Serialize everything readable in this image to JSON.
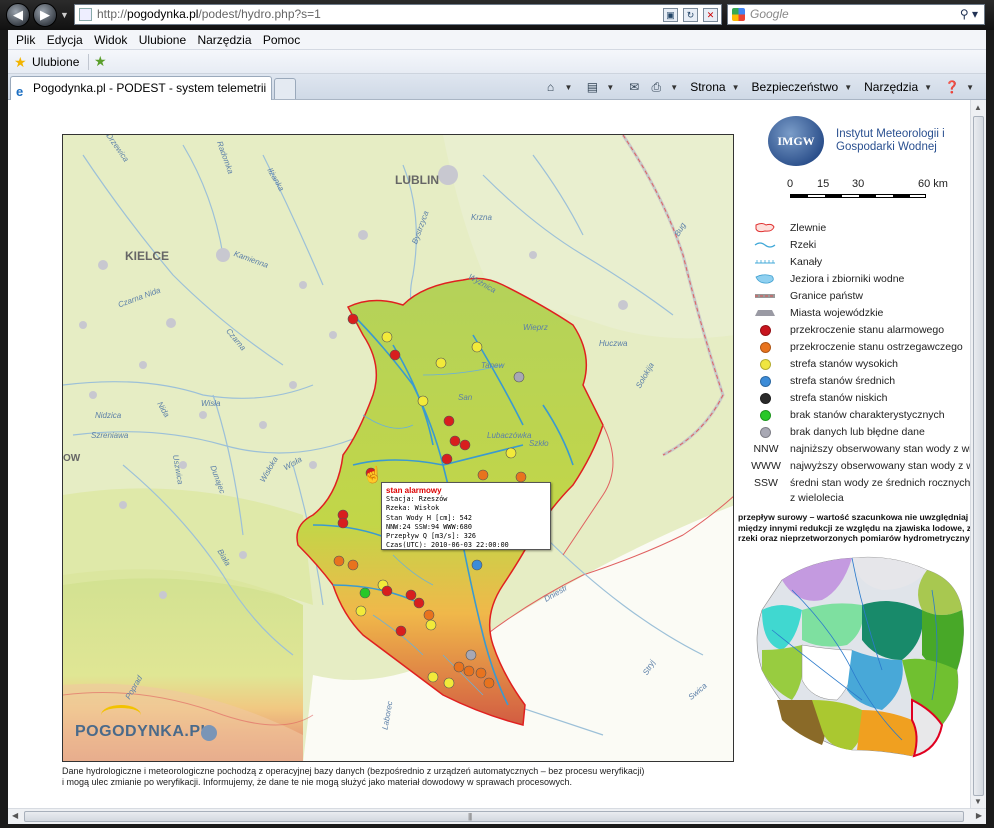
{
  "browser": {
    "url_prefix": "http://",
    "url_domain": "pogodynka.pl",
    "url_path": "/podest/hydro.php?s=1",
    "search_placeholder": "Google",
    "menu": [
      "Plik",
      "Edycja",
      "Widok",
      "Ulubione",
      "Narzędzia",
      "Pomoc"
    ],
    "favorites_label": "Ulubione",
    "tab_title": "Pogodynka.pl - PODEST - system telemetrii",
    "commands": [
      "Strona",
      "Bezpieczeństwo",
      "Narzędzia"
    ]
  },
  "map": {
    "cities": [
      "LUBLIN",
      "KIELCE",
      "OW"
    ],
    "rivers": [
      "Drzewica",
      "Radomka",
      "Iłżanka",
      "Bystrzyca",
      "Wieprz",
      "Bug",
      "Kamienna",
      "Krzna",
      "Czarna Nida",
      "Wyżnica",
      "Huczwa",
      "Tanew",
      "Solokija",
      "Czarna",
      "Wisła",
      "Nida",
      "Nidzica",
      "Wisła",
      "San",
      "Lubaczówka",
      "Szkło",
      "Szreniawa",
      "Dunajec",
      "Uszwica",
      "Wisłoka",
      "Biała",
      "Dniestr",
      "Poprad",
      "Stryj",
      "Laborec",
      "Swica"
    ],
    "logo": "POGODYNKA.PL"
  },
  "tooltip": {
    "title": "stan alarmowy",
    "station": "Stacja: Rzeszów",
    "river": "Rzeka: Wisłok",
    "water_level": "Stan Wody H [cm]: 542",
    "levels": "NNW:24 SSW:94 WWW:680",
    "flow": "Przepływ Q [m3/s]: 326",
    "time": "Czas(UTC): 2010-06-03 22:00:00"
  },
  "legend": {
    "institute": "Instytut Meteorologii i Gospodarki Wodnej",
    "institute_logo": "IMGW",
    "scale_ticks": [
      "0",
      "15",
      "30",
      "60 km"
    ],
    "items": [
      {
        "label": "Zlewnie"
      },
      {
        "label": "Rzeki"
      },
      {
        "label": "Kanały"
      },
      {
        "label": "Jeziora i zbiorniki wodne"
      },
      {
        "label": "Granice państw"
      },
      {
        "label": "Miasta wojewódzkie"
      },
      {
        "label": "przekroczenie stanu alarmowego",
        "color": "#c8141e"
      },
      {
        "label": "przekroczenie stanu ostrzegawczego",
        "color": "#e8731e"
      },
      {
        "label": "strefa stanów wysokich",
        "color": "#f0e640"
      },
      {
        "label": "strefa stanów średnich",
        "color": "#3c8cd8"
      },
      {
        "label": "strefa stanów niskich",
        "color": "#2a2a2a"
      },
      {
        "label": "brak stanów charakterystycznych",
        "color": "#28c828"
      },
      {
        "label": "brak danych lub błędne dane",
        "color": "#a8a8b4"
      }
    ],
    "abbreviations": [
      {
        "abbr": "NNW",
        "text": "najniższy obserwowany stan wody z wie"
      },
      {
        "abbr": "WWW",
        "text": "najwyższy obserwowany stan wody z wi"
      },
      {
        "abbr": "SSW",
        "text": "średni stan wody ze średnich rocznych",
        "text2": "z wielolecia"
      }
    ],
    "flow_note": [
      "przepływ surowy – wartość szacunkowa nie uwzględniaj",
      "między innymi redukcji ze względu na zjawiska lodowe, zar",
      "rzeki oraz nieprzetworzonych pomiarów hydrometrycznych"
    ]
  },
  "footnote": [
    "Dane hydrologiczne i meteorologiczne pochodzą z operacyjnej bazy danych (bezpośrednio z urządzeń automatycznych – bez procesu weryfikacji)",
    "i mogą ulec zmianie po weryfikacji. Informujemy, że dane te nie mogą służyć jako materiał dowodowy w sprawach procesowych."
  ]
}
